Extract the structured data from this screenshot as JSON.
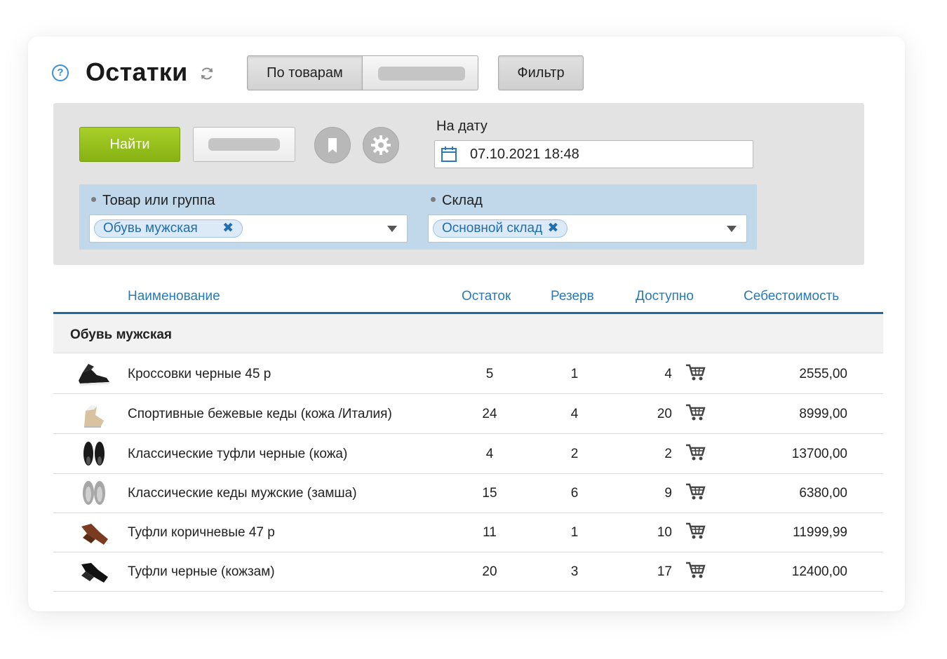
{
  "header": {
    "title": "Остатки",
    "view_tabs": {
      "active": "По товарам"
    },
    "filter_label": "Фильтр"
  },
  "filters": {
    "find_label": "Найти",
    "date_label": "На дату",
    "date_value": "07.10.2021 18:48",
    "product_label": "Товар или группа",
    "product_chip": "Обувь мужская",
    "warehouse_label": "Склад",
    "warehouse_chip": "Основной склад"
  },
  "table": {
    "columns": [
      "Наименование",
      "Остаток",
      "Резерв",
      "Доступно",
      "Себестоимость"
    ],
    "group": "Обувь мужская",
    "rows": [
      {
        "name": "Кроссовки черные 45 р",
        "stock": "5",
        "reserve": "1",
        "available": "4",
        "cost": "2555,00"
      },
      {
        "name": "Спортивные бежевые кеды (кожа /Италия)",
        "stock": "24",
        "reserve": "4",
        "available": "20",
        "cost": "8999,00"
      },
      {
        "name": "Классические туфли черные (кожа)",
        "stock": "4",
        "reserve": "2",
        "available": "2",
        "cost": "13700,00"
      },
      {
        "name": "Классические кеды мужские (замша)",
        "stock": "15",
        "reserve": "6",
        "available": "9",
        "cost": "6380,00"
      },
      {
        "name": "Туфли коричневые 47 р",
        "stock": "11",
        "reserve": "1",
        "available": "10",
        "cost": "11999,99"
      },
      {
        "name": "Туфли черные (кожзам)",
        "stock": "20",
        "reserve": "3",
        "available": "17",
        "cost": "12400,00"
      }
    ]
  },
  "colors": {
    "accent_blue": "#2b79b6",
    "find_green": "#96c11d",
    "filter_zone": "#c0d8ea"
  }
}
